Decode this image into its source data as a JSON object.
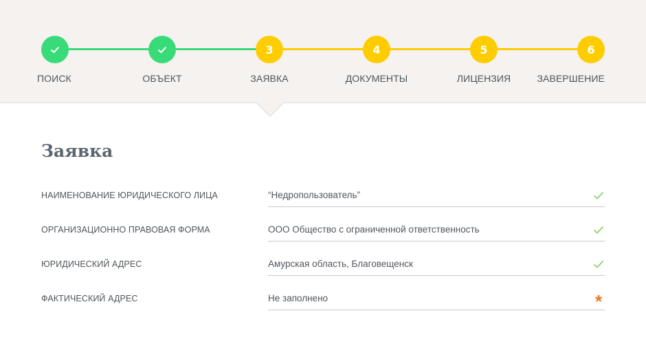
{
  "stepper": {
    "steps": [
      {
        "number": "1",
        "label": "ПОИСК",
        "state": "done"
      },
      {
        "number": "2",
        "label": "ОБЪЕКТ",
        "state": "done"
      },
      {
        "number": "3",
        "label": "ЗАЯВКА",
        "state": "current"
      },
      {
        "number": "4",
        "label": "ДОКУМЕНТЫ",
        "state": "todo"
      },
      {
        "number": "5",
        "label": "ЛИЦЕНЗИЯ",
        "state": "todo"
      },
      {
        "number": "6",
        "label": "ЗАВЕРШЕНИЕ",
        "state": "todo"
      }
    ]
  },
  "form": {
    "title": "Заявка",
    "fields": [
      {
        "label": "НАИМЕНОВАНИЕ ЮРИДИЧЕСКОГО ЛИЦА",
        "value": "“Недропользователь”",
        "status": "valid"
      },
      {
        "label": "ОРГАНИЗАЦИОННО ПРАВОВАЯ ФОРМА",
        "value": "ООО Общество с ограниченной ответственность",
        "status": "valid"
      },
      {
        "label": "ЮРИДИЧЕСКИЙ АДРЕС",
        "value": "Амурская область, Благовещенск",
        "status": "valid"
      },
      {
        "label": "ФАКТИЧЕСКИЙ АДРЕС",
        "value": "Не заполнено",
        "status": "required",
        "status_symbol": "*"
      }
    ]
  },
  "colors": {
    "done": "#39db79",
    "todo": "#ffcc00",
    "valid_check": "#8ed36b",
    "required": "#ee7623",
    "header_bg": "#f5f2ef"
  },
  "icons": {
    "done_step": "check-icon",
    "valid_field": "check-icon",
    "required_field": "asterisk-icon"
  }
}
